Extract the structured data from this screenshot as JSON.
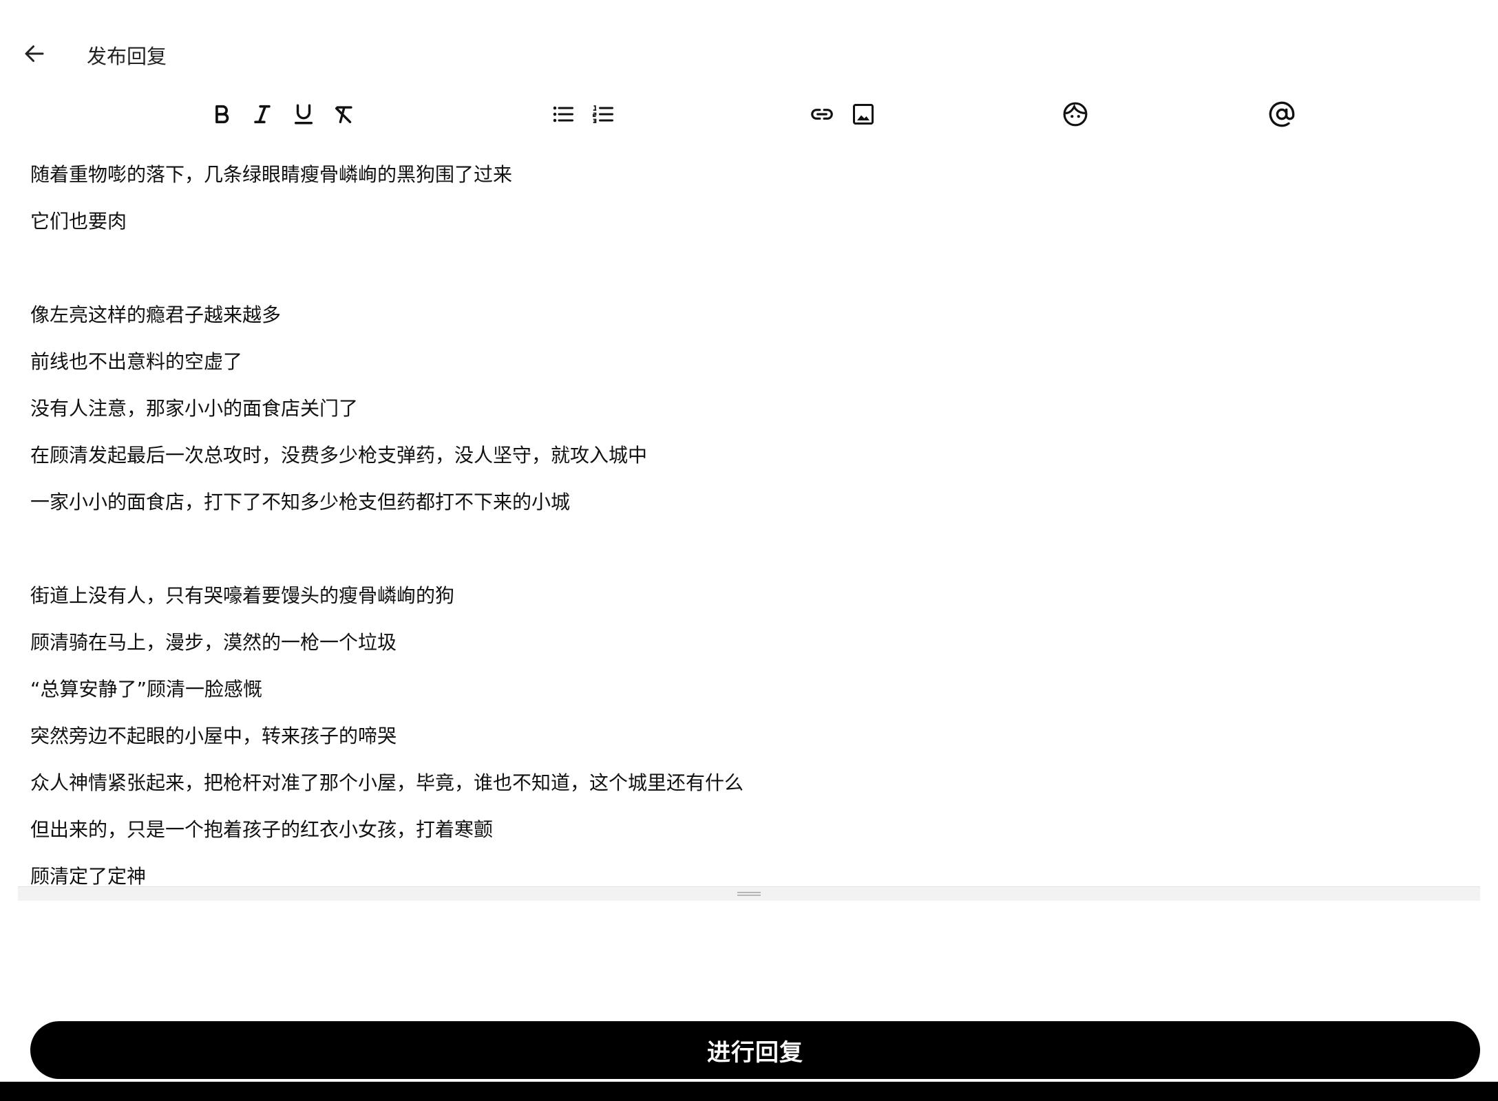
{
  "header": {
    "back_icon": "arrow-left-icon",
    "title": "发布回复"
  },
  "toolbar": {
    "tools": [
      {
        "name": "bold",
        "icon": "bold-icon"
      },
      {
        "name": "italic",
        "icon": "italic-icon"
      },
      {
        "name": "underline",
        "icon": "underline-icon"
      },
      {
        "name": "clear-format",
        "icon": "clear-format-icon"
      },
      {
        "name": "bulleted-list",
        "icon": "bulleted-list-icon"
      },
      {
        "name": "numbered-list",
        "icon": "numbered-list-icon"
      },
      {
        "name": "link",
        "icon": "link-icon"
      },
      {
        "name": "image",
        "icon": "image-icon"
      },
      {
        "name": "emoji",
        "icon": "emoji-icon"
      },
      {
        "name": "mention",
        "icon": "at-sign-icon"
      }
    ]
  },
  "editor": {
    "lines": [
      "随着重物嘭的落下，几条绿眼睛瘦骨嶙峋的黑狗围了过来",
      "它们也要肉",
      "",
      "像左亮这样的瘾君子越来越多",
      "前线也不出意料的空虚了",
      "没有人注意，那家小小的面食店关门了",
      "在顾清发起最后一次总攻时，没费多少枪支弹药，没人坚守，就攻入城中",
      "一家小小的面食店，打下了不知多少枪支但药都打不下来的小城",
      "",
      "街道上没有人，只有哭嚎着要馒头的瘦骨嶙峋的狗",
      "顾清骑在马上，漫步，漠然的一枪一个垃圾",
      "“总算安静了”顾清一脸感慨",
      "突然旁边不起眼的小屋中，转来孩子的啼哭",
      "众人神情紧张起来，把枪杆对准了那个小屋，毕竟，谁也不知道，这个城里还有什么",
      "但出来的，只是一个抱着孩子的红衣小女孩，打着寒颤",
      "顾清定了定神"
    ]
  },
  "submit": {
    "label": "进行回复"
  },
  "colors": {
    "accent": "#000000",
    "background": "#ffffff",
    "text": "#111111"
  }
}
